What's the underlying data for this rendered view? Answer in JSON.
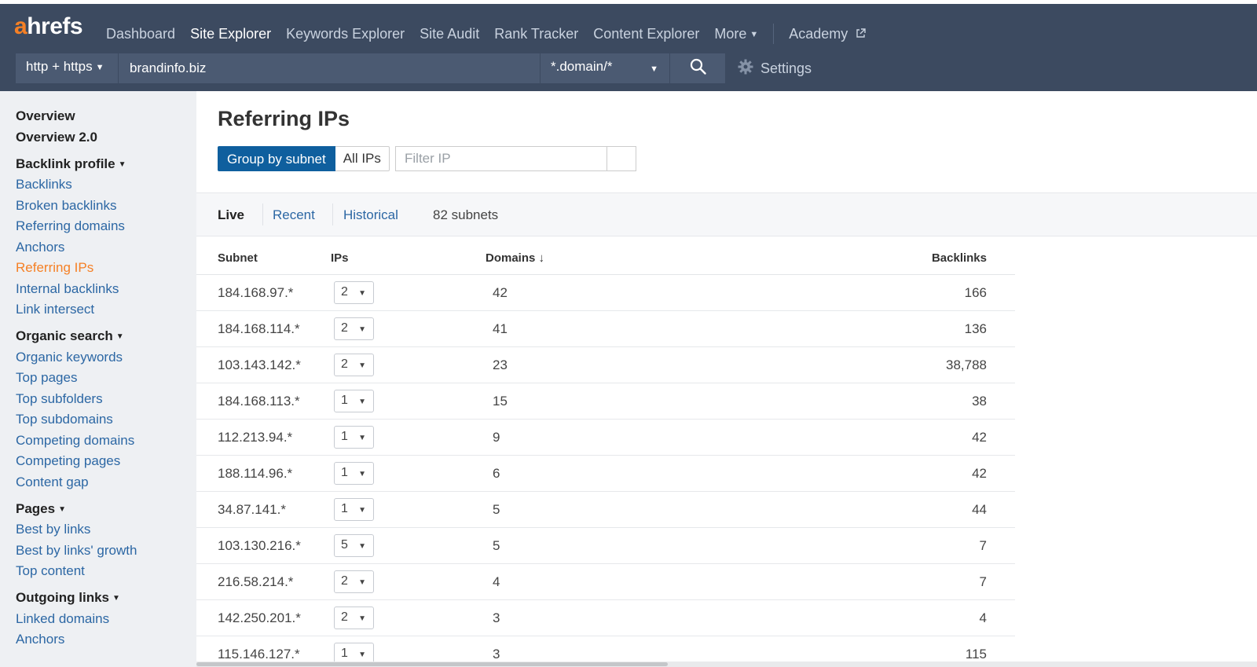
{
  "logo": {
    "first": "a",
    "rest": "hrefs"
  },
  "nav": {
    "items": [
      "Dashboard",
      "Site Explorer",
      "Keywords Explorer",
      "Site Audit",
      "Rank Tracker",
      "Content Explorer"
    ],
    "more": "More",
    "academy": "Academy"
  },
  "search": {
    "protocol": "http + https",
    "url": "brandinfo.biz",
    "mode": "*.domain/*",
    "settings": "Settings"
  },
  "sidebar": {
    "overview": "Overview",
    "overview2": "Overview 2.0",
    "backlink_profile": "Backlink profile",
    "backlink_items": [
      "Backlinks",
      "Broken backlinks",
      "Referring domains",
      "Anchors",
      "Referring IPs",
      "Internal backlinks",
      "Link intersect"
    ],
    "organic_search": "Organic search",
    "organic_items": [
      "Organic keywords",
      "Top pages",
      "Top subfolders",
      "Top subdomains",
      "Competing domains",
      "Competing pages",
      "Content gap"
    ],
    "pages": "Pages",
    "pages_items": [
      "Best by links",
      "Best by links' growth",
      "Top content"
    ],
    "outgoing_links": "Outgoing links",
    "outgoing_items": [
      "Linked domains",
      "Anchors"
    ]
  },
  "main": {
    "title": "Referring IPs",
    "group_by_subnet": "Group by subnet",
    "all_ips": "All IPs",
    "filter_placeholder": "Filter IP",
    "tabs": [
      "Live",
      "Recent",
      "Historical"
    ],
    "count": "82 subnets"
  },
  "table": {
    "headers": {
      "subnet": "Subnet",
      "ips": "IPs",
      "domains": "Domains ↓",
      "backlinks": "Backlinks"
    },
    "rows": [
      {
        "subnet": "184.168.97.*",
        "ips": "2",
        "domains": "42",
        "backlinks": "166"
      },
      {
        "subnet": "184.168.114.*",
        "ips": "2",
        "domains": "41",
        "backlinks": "136"
      },
      {
        "subnet": "103.143.142.*",
        "ips": "2",
        "domains": "23",
        "backlinks": "38,788"
      },
      {
        "subnet": "184.168.113.*",
        "ips": "1",
        "domains": "15",
        "backlinks": "38"
      },
      {
        "subnet": "112.213.94.*",
        "ips": "1",
        "domains": "9",
        "backlinks": "42"
      },
      {
        "subnet": "188.114.96.*",
        "ips": "1",
        "domains": "6",
        "backlinks": "42"
      },
      {
        "subnet": "34.87.141.*",
        "ips": "1",
        "domains": "5",
        "backlinks": "44"
      },
      {
        "subnet": "103.130.216.*",
        "ips": "5",
        "domains": "5",
        "backlinks": "7"
      },
      {
        "subnet": "216.58.214.*",
        "ips": "2",
        "domains": "4",
        "backlinks": "7"
      },
      {
        "subnet": "142.250.201.*",
        "ips": "2",
        "domains": "3",
        "backlinks": "4"
      },
      {
        "subnet": "115.146.127.*",
        "ips": "1",
        "domains": "3",
        "backlinks": "115"
      }
    ]
  },
  "colors": {
    "header_bg": "#3c4a60",
    "accent_orange": "#f58025",
    "link_blue": "#2c67a4",
    "primary_button": "#0f5f9e"
  }
}
